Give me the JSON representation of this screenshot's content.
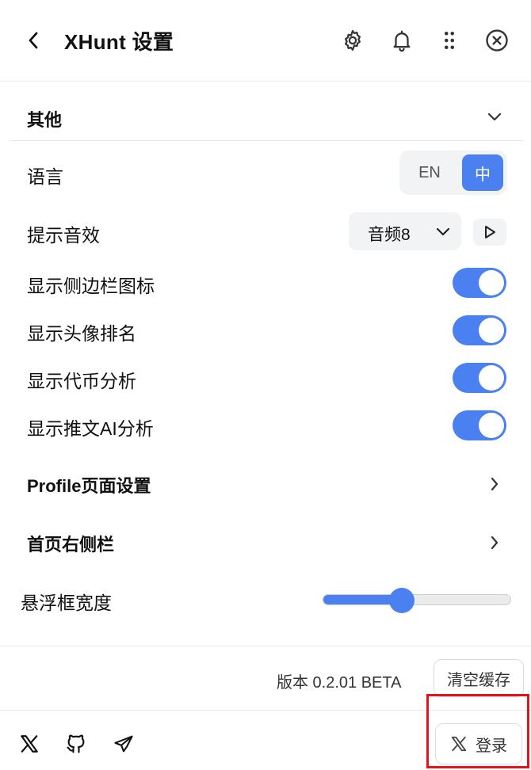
{
  "header": {
    "title": "XHunt 设置",
    "icons": [
      "back-icon",
      "gear-icon",
      "bell-icon",
      "drag-dots-icon",
      "close-circle-icon"
    ]
  },
  "section": {
    "title": "其他",
    "expanded": true
  },
  "settings": {
    "language_label": "语言",
    "language_options": [
      "EN",
      "中"
    ],
    "language_selected": "中",
    "sound_label": "提示音效",
    "sound_value": "音频8",
    "toggles": [
      {
        "label": "显示侧边栏图标",
        "on": true
      },
      {
        "label": "显示头像排名",
        "on": true
      },
      {
        "label": "显示代币分析",
        "on": true
      },
      {
        "label": "显示推文AI分析",
        "on": true
      }
    ],
    "nav_items": [
      {
        "label": "Profile页面设置"
      },
      {
        "label": "首页右侧栏"
      }
    ],
    "slider_label": "悬浮框宽度",
    "slider_value": 0.42
  },
  "footer": {
    "version": "版本 0.2.01  BETA",
    "clear_cache_label": "清空缓存",
    "social_icons": [
      "x-icon",
      "github-icon",
      "telegram-icon"
    ],
    "login_label": "登录"
  },
  "colors": {
    "accent": "#4a80f0",
    "highlight": "#e8101a",
    "panel_bg": "#f2f3f5"
  }
}
